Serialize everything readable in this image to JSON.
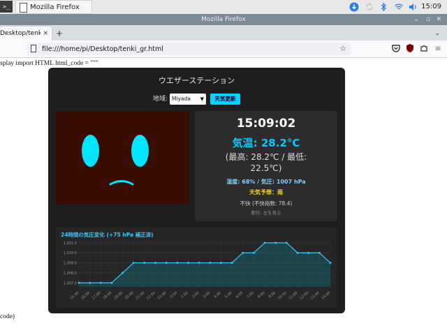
{
  "taskbar": {
    "terminal_label": ">_",
    "app_label": "Mozilla Firefox",
    "clock": "15:09"
  },
  "window": {
    "title": "Mozilla Firefox"
  },
  "tabs": [
    {
      "label": "Desktop/tenki_gr",
      "close": "×"
    }
  ],
  "newtab_label": "+",
  "tablist_label": "⌄",
  "nav": {
    "url": "file:///home/pi/Desktop/tenki_gr.html",
    "back": "←",
    "forward": "→",
    "reload": "↻",
    "star": "☆",
    "menu": "≡"
  },
  "page": {
    "top_text": "splay import HTML html_code = \"\"\"",
    "bottom_text": "code)",
    "card_title": "ウエザーステーション",
    "region_label": "地域:",
    "region_selected": "Miyada",
    "update_button": "天気更新",
    "time": "15:09:02",
    "temp": "気温: 28.2°C",
    "hilo_line1": "(最高: 28.2℃ / 最低:",
    "hilo_line2": "22.5℃)",
    "humidity": "湿度: 68% / 気圧: 1007 hPa",
    "forecast": "天気予想：雨",
    "discomfort": "不快 (不快指数: 78.4)",
    "action": "動作: 左を見る"
  },
  "colors": {
    "accent": "#00d4ff",
    "face_bg": "#3a0d04",
    "eye": "#00e5ff",
    "forecast": "#ffd23c",
    "chart_line": "#36c9ff"
  },
  "chart_data": {
    "type": "area",
    "title": "24時間の気圧変化 (+75 hPa 補正済)",
    "x": [
      "15:00",
      "16:00",
      "17:00",
      "18:00",
      "19:00",
      "20:00",
      "21:00",
      "22:00",
      "23:00",
      "0:00",
      "1:00",
      "2:00",
      "3:00",
      "4:00",
      "5:00",
      "6:00",
      "7:00",
      "8:00",
      "9:00",
      "10:00",
      "11:00",
      "12:00",
      "13:00",
      "14:00"
    ],
    "values": [
      1007.0,
      1007.0,
      1007.0,
      1007.0,
      1008.0,
      1009.0,
      1009.0,
      1009.0,
      1009.0,
      1009.0,
      1009.0,
      1009.0,
      1009.0,
      1009.0,
      1009.0,
      1010.0,
      1010.0,
      1011.0,
      1011.0,
      1011.0,
      1010.0,
      1010.0,
      1010.0,
      1009.0
    ],
    "yticks": [
      "1,007.0",
      "1,008.0",
      "1,009.0",
      "1,010.0",
      "1,011.0"
    ],
    "ylim": [
      1006.6,
      1011.2
    ],
    "grid": true,
    "xlabel": "",
    "ylabel": ""
  }
}
